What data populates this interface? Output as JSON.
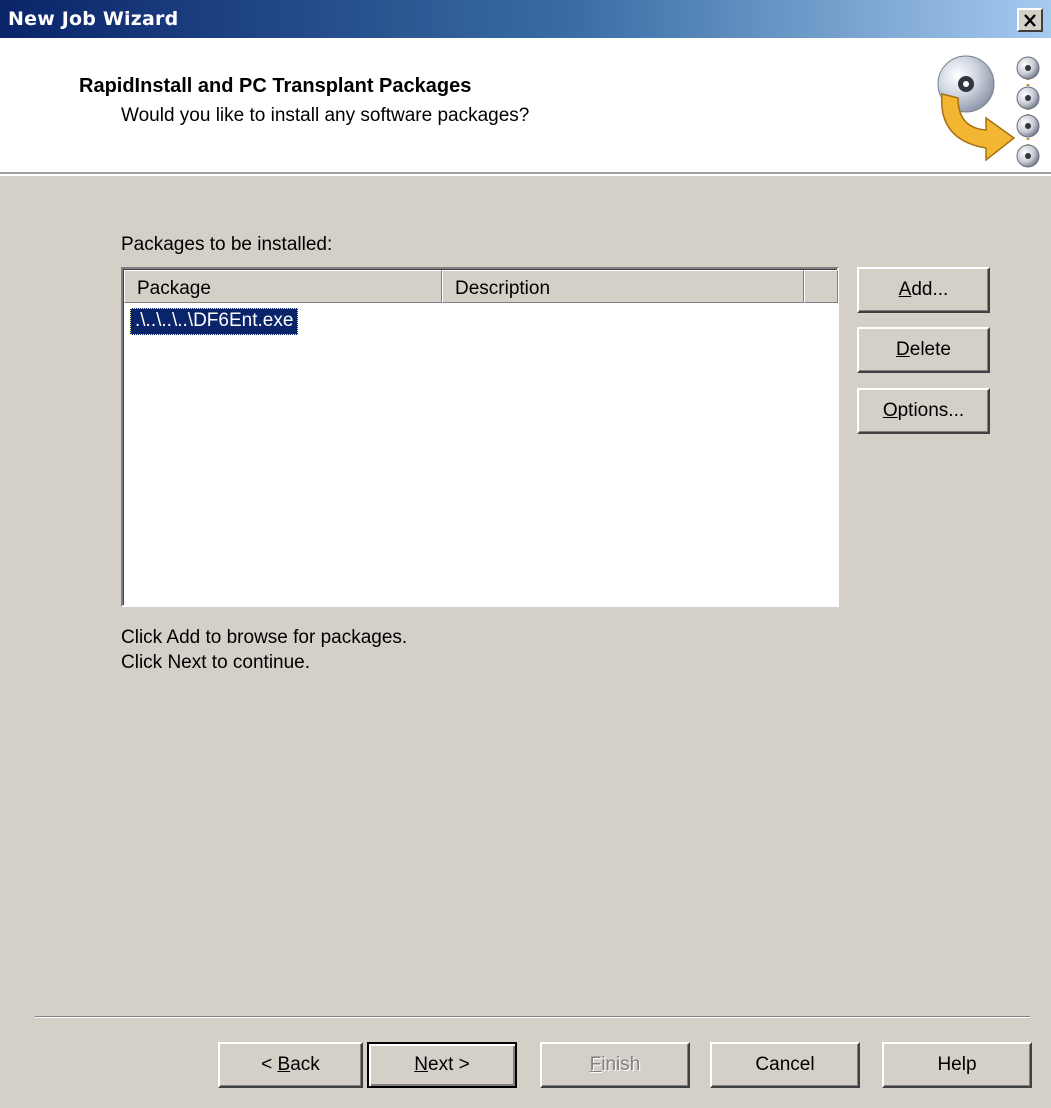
{
  "window": {
    "title": "New Job Wizard",
    "close_label": "×"
  },
  "header": {
    "title": "RapidInstall and PC Transplant Packages",
    "subtitle": "Would you like to install any software packages?",
    "graphic_icon": "cd-install-arrow-icon"
  },
  "main": {
    "packages_label": "Packages to be installed:",
    "list": {
      "columns": [
        "Package",
        "Description",
        ""
      ],
      "rows": [
        {
          "package": ".\\..\\..\\..\\DF6Ent.exe",
          "description": "",
          "selected": true
        }
      ]
    },
    "side_buttons": {
      "add": {
        "mnemonic": "A",
        "rest": "dd..."
      },
      "delete": {
        "mnemonic": "D",
        "rest": "elete"
      },
      "options": {
        "mnemonic": "O",
        "rest": "ptions..."
      }
    },
    "hint_line1": "Click Add to browse for packages.",
    "hint_line2": "Click Next to continue."
  },
  "footer": {
    "back": {
      "prefix": "< ",
      "mnemonic": "B",
      "rest": "ack"
    },
    "next": {
      "mnemonic": "N",
      "rest": "ext >"
    },
    "finish": {
      "mnemonic": "F",
      "rest": "inish",
      "disabled": true
    },
    "cancel": "Cancel",
    "help": "Help"
  }
}
